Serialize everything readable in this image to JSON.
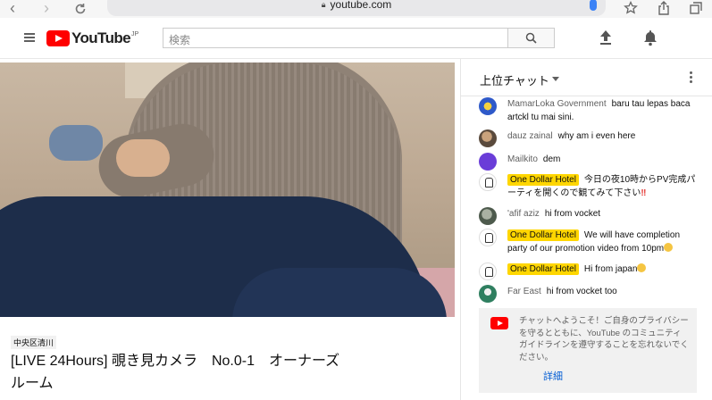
{
  "browser": {
    "url": "youtube.com",
    "icons": [
      "back-icon",
      "forward-icon",
      "reload-icon",
      "lock-icon",
      "mic-icon",
      "star-icon",
      "share-icon",
      "tabs-icon"
    ]
  },
  "masthead": {
    "logo_text": "YouTube",
    "logo_region": "JP",
    "search_placeholder": "検索"
  },
  "video": {
    "location": "中央区清川",
    "title": "[LIVE 24Hours] 覗き見カメラ　No.0-1　オーナーズルーム"
  },
  "chat": {
    "header_title": "上位チャット",
    "messages": [
      {
        "author": "MamarLoka Government",
        "text": "baru tau lepas baca artckl tu mai sini.",
        "owner": false
      },
      {
        "author": "dauz zainal",
        "text": "why am i even here",
        "owner": false
      },
      {
        "author": "Mailkito",
        "text": "dem",
        "owner": false
      },
      {
        "author": "One Dollar Hotel",
        "text": "今日の夜10時からPV完成パーティを開くので観てみて下さい",
        "suffix": "‼",
        "owner": true
      },
      {
        "author": "'afif aziz",
        "text": "hi from vocket",
        "owner": false
      },
      {
        "author": "One Dollar Hotel",
        "text": "We will have completion party of our promotion video from 10pm",
        "owner": true
      },
      {
        "author": "One Dollar Hotel",
        "text": "Hi from japan",
        "owner": true
      },
      {
        "author": "Far East",
        "text": "hi from vocket too",
        "owner": false
      }
    ],
    "welcome_text": "チャットへようこそ！ご自身のプライバシーを守るとともに、YouTube のコミュニティ ガイドラインを遵守することを忘れないでください。",
    "welcome_link": "詳細"
  },
  "colors": {
    "brand_red": "#ff0000",
    "owner_badge": "#ffd600",
    "link_blue": "#065fd4"
  }
}
